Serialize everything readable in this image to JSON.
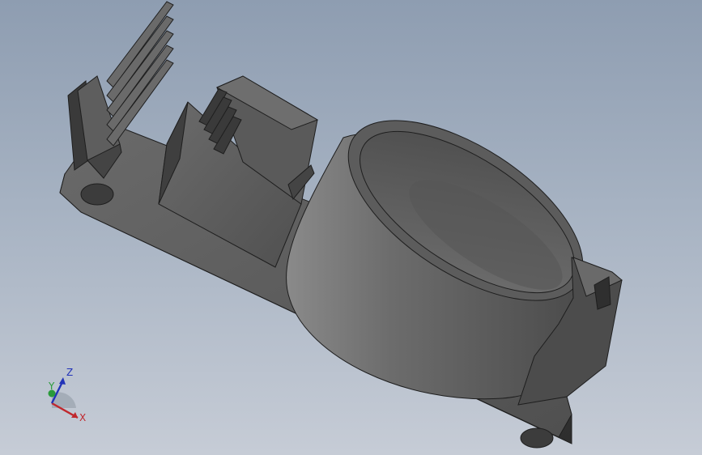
{
  "viewport": {
    "background_top": "#8e9db1",
    "background_bottom": "#c6ccd6"
  },
  "model": {
    "material_color": "#585858",
    "edge_color": "#1e1e1e"
  },
  "triad": {
    "x_label": "X",
    "y_label": "Y",
    "z_label": "Z",
    "x_color": "#c0282d",
    "y_color": "#2a9a3a",
    "z_color": "#2233b8"
  }
}
